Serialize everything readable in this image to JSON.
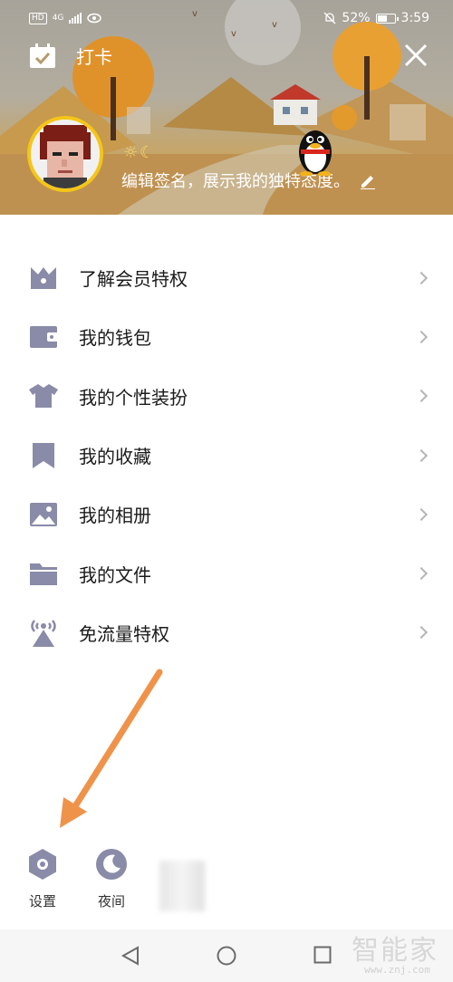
{
  "status_bar": {
    "hd": "HD",
    "network": "4G",
    "battery": "52%",
    "time": "3:59"
  },
  "header": {
    "checkin_label": "打卡",
    "signature": "编辑签名，展示我的独特态度。",
    "badges": "☼☾"
  },
  "menu": {
    "items": [
      {
        "label": "了解会员特权",
        "icon": "crown-icon"
      },
      {
        "label": "我的钱包",
        "icon": "wallet-icon"
      },
      {
        "label": "我的个性装扮",
        "icon": "shirt-icon"
      },
      {
        "label": "我的收藏",
        "icon": "bookmark-icon"
      },
      {
        "label": "我的相册",
        "icon": "photo-icon"
      },
      {
        "label": "我的文件",
        "icon": "folder-icon"
      },
      {
        "label": "免流量特权",
        "icon": "antenna-icon"
      }
    ]
  },
  "toolbar": {
    "settings_label": "设置",
    "night_label": "夜间"
  },
  "watermark": {
    "brand": "智能家",
    "url": "www.znj.com"
  },
  "colors": {
    "icon": "#8a8ba8",
    "arrow": "#f0934a",
    "avatar_ring": "#f5c518"
  }
}
